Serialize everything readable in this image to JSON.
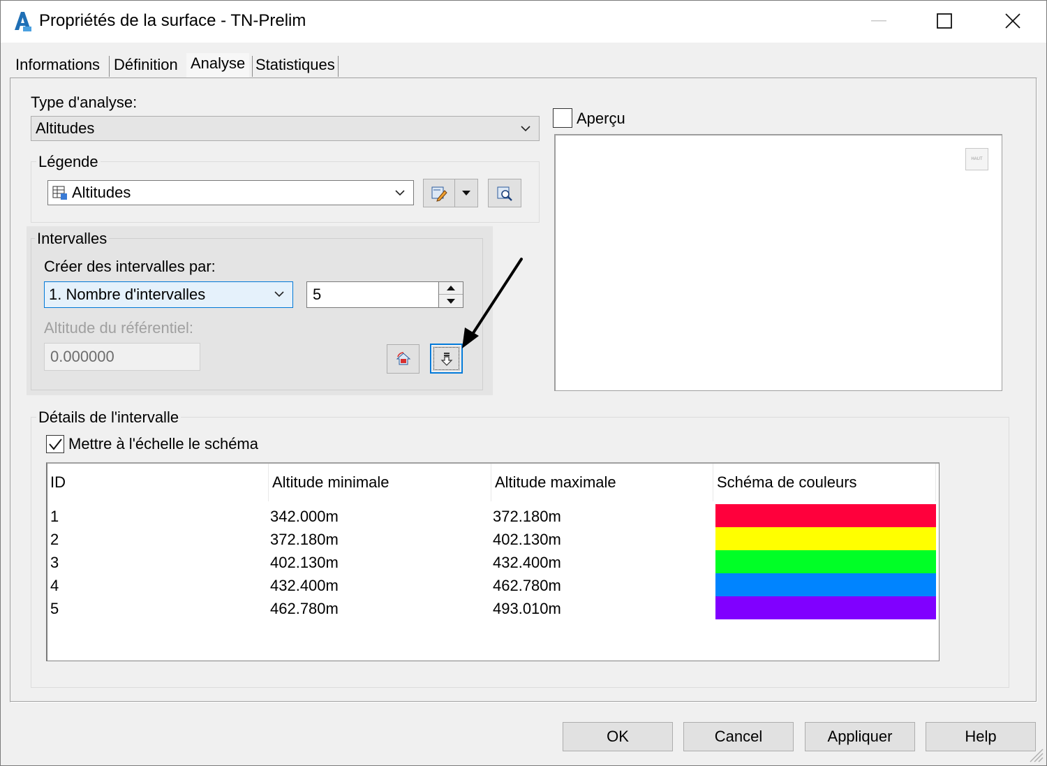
{
  "window": {
    "title": "Propriétés de la surface - TN-Prelim",
    "app_icon": "autocad-icon",
    "controls": [
      "minimize-icon",
      "maximize-icon",
      "close-icon"
    ]
  },
  "tabs": [
    {
      "label": "Informations",
      "active": false
    },
    {
      "label": "Définition",
      "active": false
    },
    {
      "label": "Analyse",
      "active": true
    },
    {
      "label": "Statistiques",
      "active": false
    }
  ],
  "analysis": {
    "type_label": "Type d'analyse:",
    "type_value": "Altitudes"
  },
  "legend": {
    "group_title": "Légende",
    "value": "Altitudes",
    "edit_icon": "edit-style-icon",
    "dropdown_icon": "dropdown-arrow-icon",
    "view_icon": "zoom-preview-icon"
  },
  "intervals": {
    "group_title": "Intervalles",
    "create_by_label": "Créer des intervalles par:",
    "create_by_value": "1. Nombre d'intervalles",
    "count_value": "5",
    "datum_label": "Altitude du référentiel:",
    "datum_value": "0.000000",
    "recalc_icon": "recalculate-icon",
    "run_icon": "run-analysis-icon"
  },
  "preview": {
    "checkbox_label": "Aperçu",
    "checked": false,
    "cube_label": "HAUT"
  },
  "details": {
    "group_title": "Détails de l'intervalle",
    "scale_label": "Mettre à l'échelle le schéma",
    "scale_checked": true,
    "columns": [
      "ID",
      "Altitude minimale",
      "Altitude maximale",
      "Schéma de couleurs"
    ],
    "rows": [
      {
        "id": "1",
        "min": "342.000m",
        "max": "372.180m",
        "color": "#ff003c"
      },
      {
        "id": "2",
        "min": "372.180m",
        "max": "402.130m",
        "color": "#ffff00"
      },
      {
        "id": "3",
        "min": "402.130m",
        "max": "432.400m",
        "color": "#00ff26"
      },
      {
        "id": "4",
        "min": "432.400m",
        "max": "462.780m",
        "color": "#0084ff"
      },
      {
        "id": "5",
        "min": "462.780m",
        "max": "493.010m",
        "color": "#8000ff"
      }
    ]
  },
  "footer": {
    "ok": "OK",
    "cancel": "Cancel",
    "apply": "Appliquer",
    "help": "Help"
  }
}
